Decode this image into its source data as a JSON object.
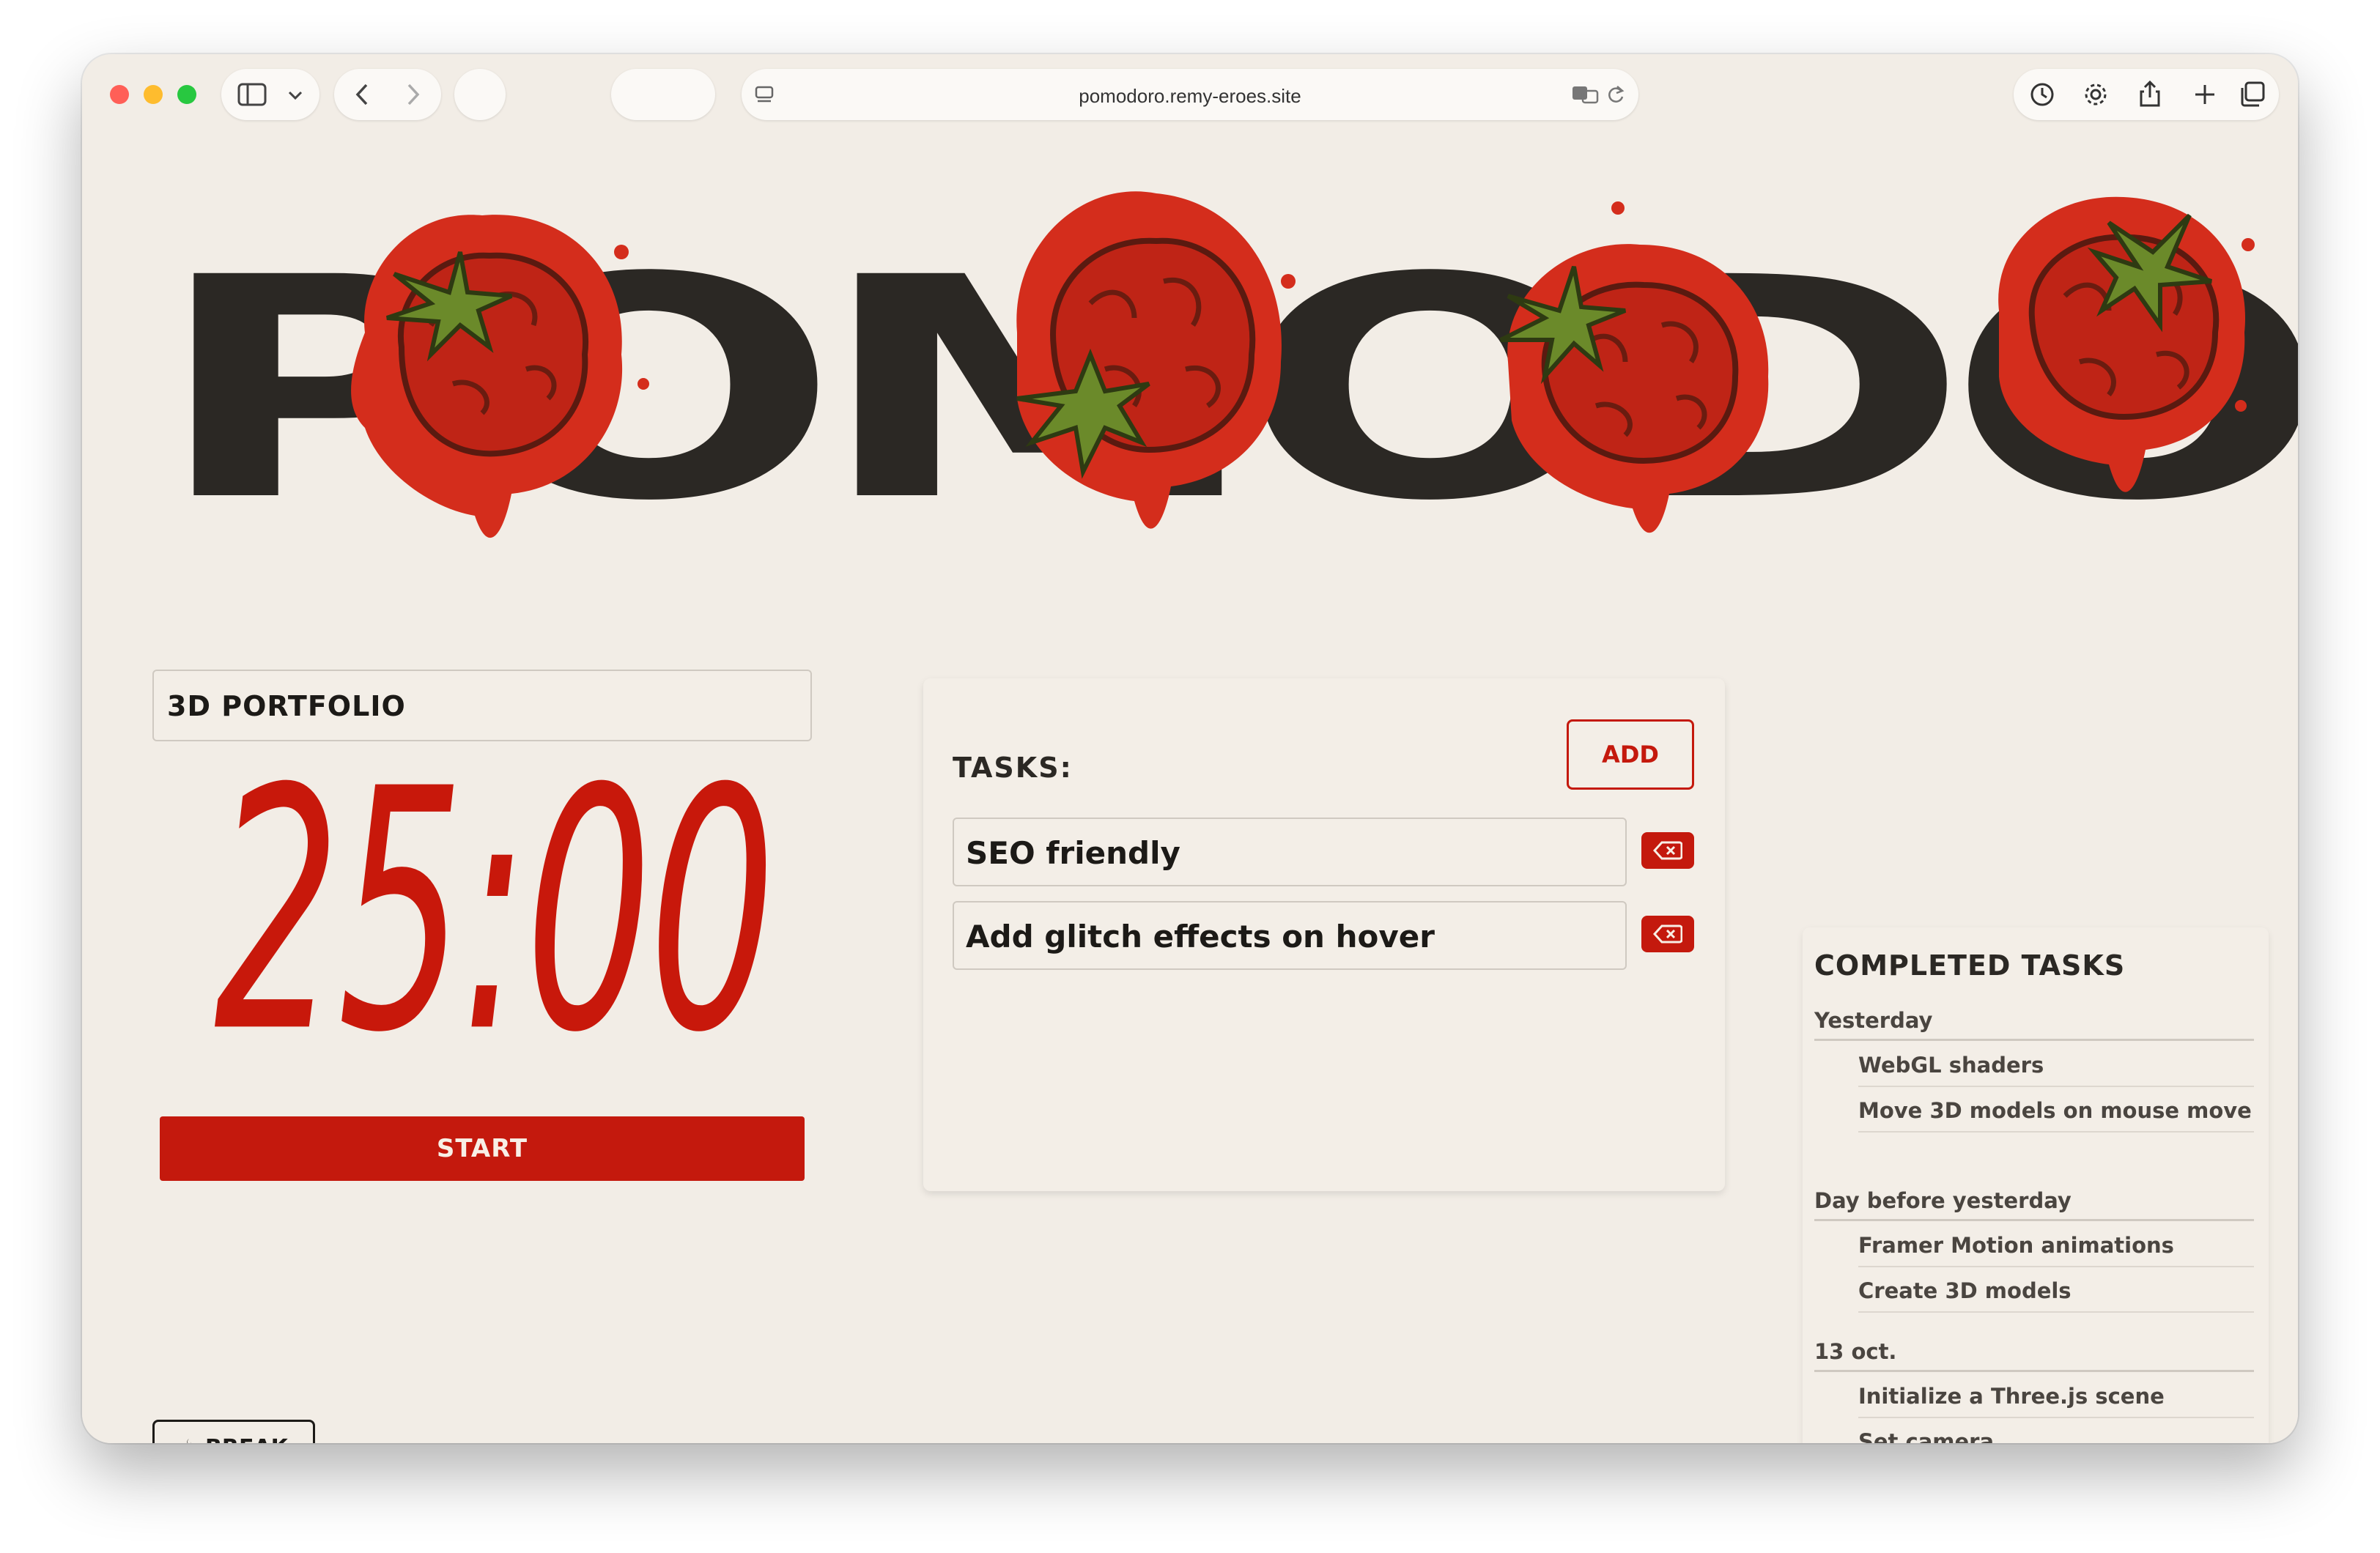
{
  "browser": {
    "url": "pomodoro.remy-eroes.site"
  },
  "app": {
    "title": "POMODORO",
    "project_name": "3D PORTFOLIO",
    "timer": "25:00",
    "start_label": "START",
    "break_label": "BREAK",
    "break_emoji": "☕"
  },
  "tasks": {
    "title": "TASKS:",
    "add_label": "ADD",
    "items": [
      {
        "text": "SEO friendly"
      },
      {
        "text": "Add glitch effects on hover"
      }
    ]
  },
  "completed": {
    "title": "COMPLETED TASKS",
    "groups": [
      {
        "label": "Yesterday",
        "items": [
          "WebGL shaders",
          "Move 3D models on mouse move"
        ]
      },
      {
        "label": "Day before yesterday",
        "items": [
          "Framer Motion animations",
          "Create 3D models"
        ]
      },
      {
        "label": "13 oct.",
        "items": [
          "Initialize a Three.js scene",
          "Set camera"
        ]
      }
    ]
  },
  "colors": {
    "accent": "#c4190d",
    "background": "#f2ede6",
    "text": "#2b2824"
  }
}
